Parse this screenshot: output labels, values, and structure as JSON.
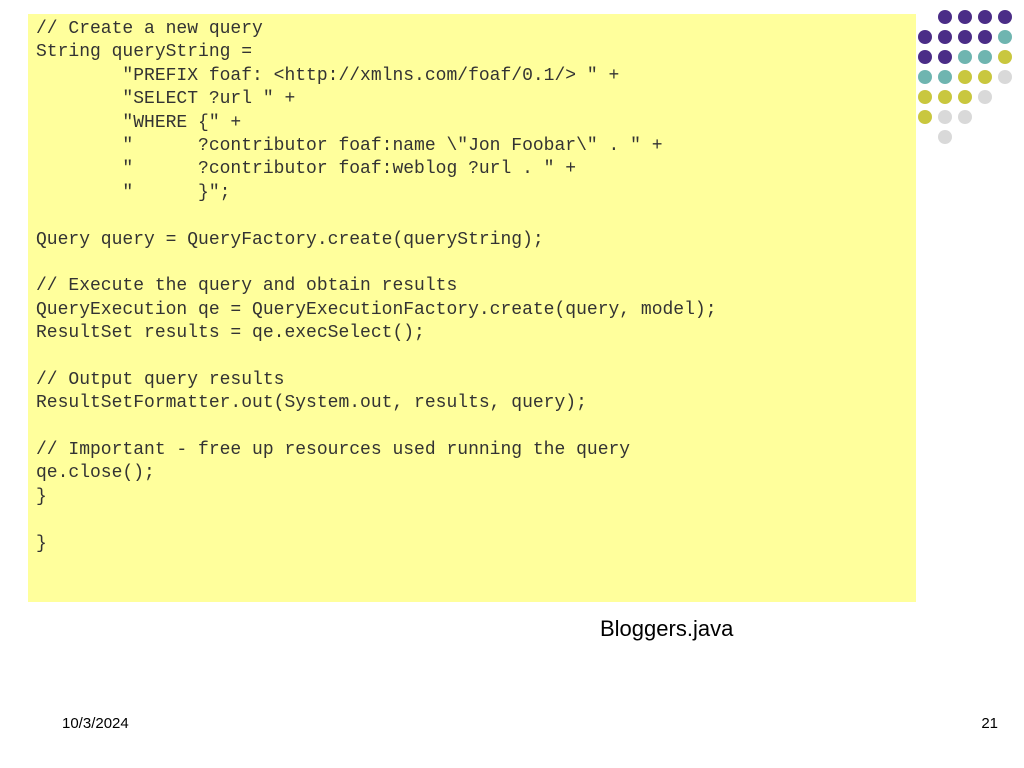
{
  "code": "// Create a new query\nString queryString =\n        \"PREFIX foaf: <http://xmlns.com/foaf/0.1/> \" +\n        \"SELECT ?url \" +\n        \"WHERE {\" +\n        \"      ?contributor foaf:name \\\"Jon Foobar\\\" . \" +\n        \"      ?contributor foaf:weblog ?url . \" +\n        \"      }\";\n\nQuery query = QueryFactory.create(queryString);\n\n// Execute the query and obtain results\nQueryExecution qe = QueryExecutionFactory.create(query, model);\nResultSet results = qe.execSelect();\n\n// Output query results\nResultSetFormatter.out(System.out, results, query);\n\n// Important - free up resources used running the query\nqe.close();\n}\n\n}",
  "caption": "Bloggers.java",
  "date": "10/3/2024",
  "page": "21",
  "dot_rows": [
    [
      "ph",
      "ph",
      "ph",
      "pu",
      "pu",
      "pu",
      "pu"
    ],
    [
      "ph",
      "ph",
      "pu",
      "pu",
      "pu",
      "pu",
      "te"
    ],
    [
      "ph",
      "pu",
      "pu",
      "pu",
      "te",
      "te",
      "ye"
    ],
    [
      "pu",
      "te",
      "te",
      "te",
      "ye",
      "ye",
      "gy"
    ],
    [
      "ph",
      "te",
      "ye",
      "ye",
      "ye",
      "gy",
      "ph"
    ],
    [
      "ph",
      "ph",
      "ye",
      "gy",
      "gy",
      "ph",
      "ph"
    ],
    [
      "ph",
      "ph",
      "ph",
      "gy",
      "ph",
      "ph",
      "ph"
    ]
  ]
}
